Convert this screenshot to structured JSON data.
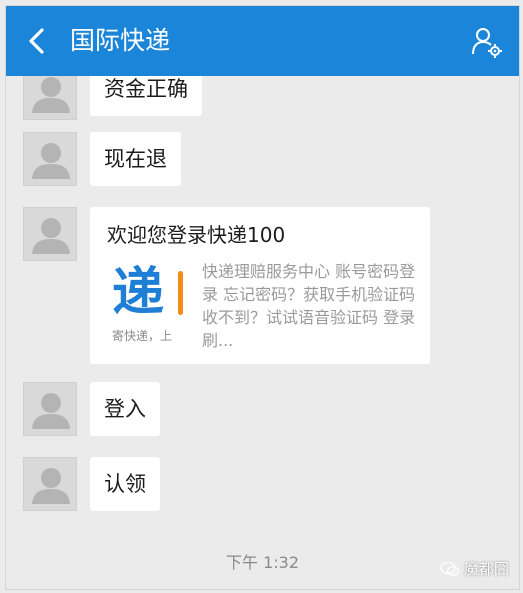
{
  "header": {
    "title": "国际快递"
  },
  "messages": [
    {
      "text": "资金正确"
    },
    {
      "text": "现在退"
    },
    {
      "title": "欢迎您登录快递100",
      "thumb_big": "递",
      "thumb_small": "寄快递，上",
      "desc": "快递理赔服务中心 账号密码登录 忘记密码？获取手机验证码 收不到？试试语音验证码 登录 刷..."
    },
    {
      "text": "登入"
    },
    {
      "text": "认领"
    }
  ],
  "timestamp": "下午 1:32",
  "watermark": "魔都囧",
  "colors": {
    "header": "#1b86d9",
    "background": "#ebebeb",
    "bubble": "#ffffff"
  }
}
